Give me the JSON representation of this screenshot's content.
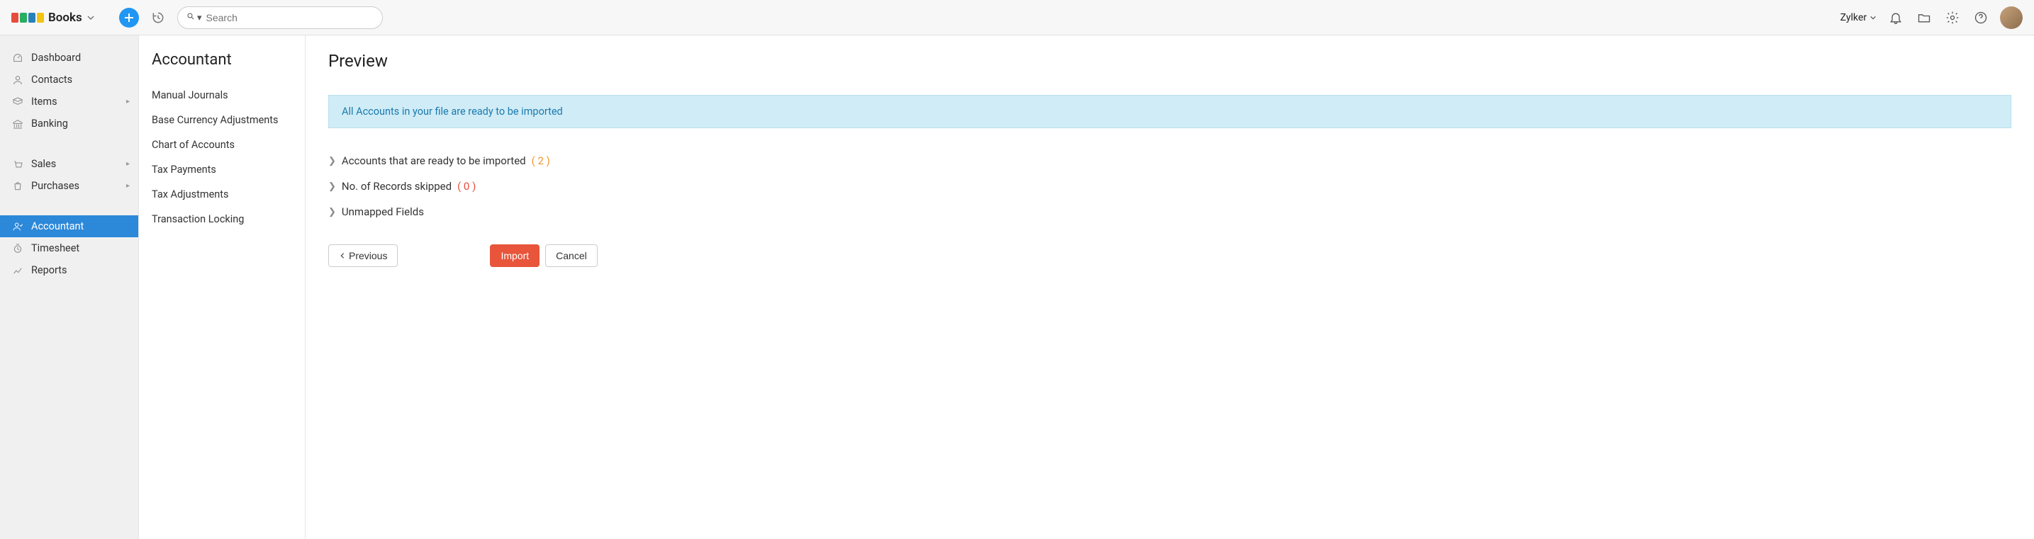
{
  "app": {
    "name": "Books"
  },
  "header": {
    "search_placeholder": "Search",
    "org_name": "Zylker"
  },
  "sidebar": {
    "items": [
      {
        "label": "Dashboard"
      },
      {
        "label": "Contacts"
      },
      {
        "label": "Items"
      },
      {
        "label": "Banking"
      },
      {
        "label": "Sales"
      },
      {
        "label": "Purchases"
      },
      {
        "label": "Accountant"
      },
      {
        "label": "Timesheet"
      },
      {
        "label": "Reports"
      }
    ]
  },
  "submenu": {
    "title": "Accountant",
    "items": [
      {
        "label": "Manual Journals"
      },
      {
        "label": "Base Currency Adjustments"
      },
      {
        "label": "Chart of Accounts"
      },
      {
        "label": "Tax Payments"
      },
      {
        "label": "Tax Adjustments"
      },
      {
        "label": "Transaction Locking"
      }
    ]
  },
  "main": {
    "title": "Preview",
    "banner": "All Accounts in your file are ready to be imported",
    "rows": [
      {
        "label": "Accounts that are ready to be imported",
        "count": "( 2 )",
        "count_class": "count-ok"
      },
      {
        "label": "No. of Records skipped",
        "count": "( 0 )",
        "count_class": "count-bad"
      },
      {
        "label": "Unmapped Fields",
        "count": "",
        "count_class": ""
      }
    ],
    "buttons": {
      "previous": "Previous",
      "import": "Import",
      "cancel": "Cancel"
    }
  }
}
